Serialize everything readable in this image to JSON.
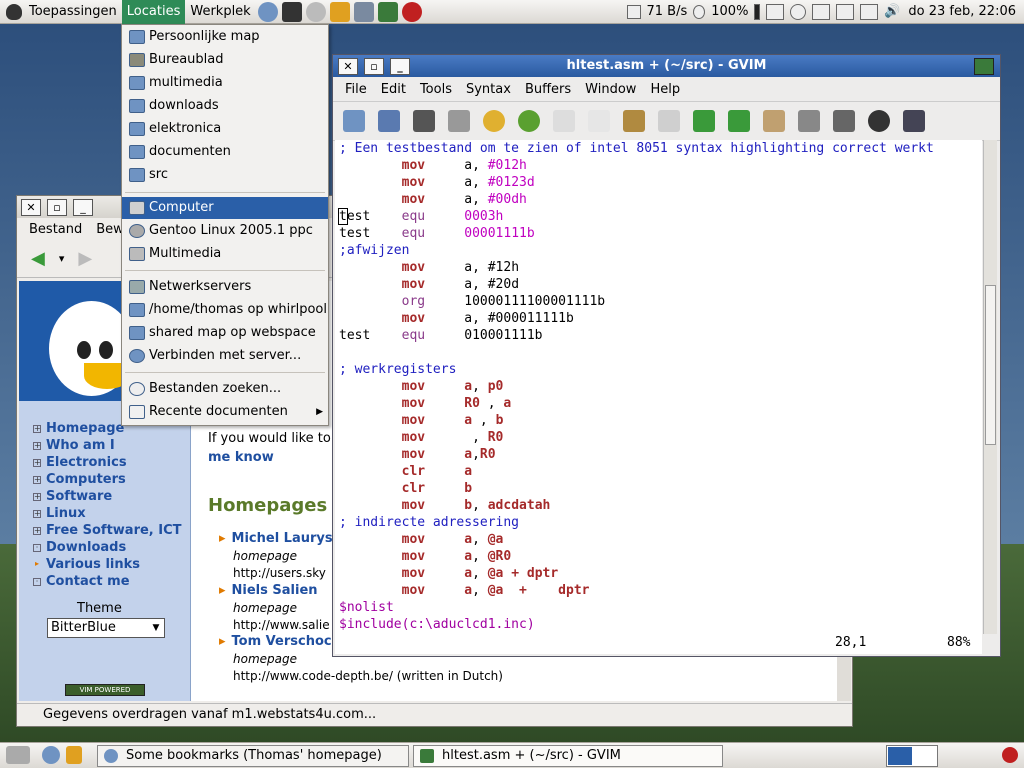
{
  "top_panel": {
    "menus": [
      "Toepassingen",
      "Locaties",
      "Werkplek"
    ],
    "net_speed": "71 B/s",
    "battery": "100%",
    "datetime": "do 23 feb, 22:06"
  },
  "places_menu": {
    "items": [
      "Persoonlijke map",
      "Bureaublad",
      "multimedia",
      "downloads",
      "elektronica",
      "documenten",
      "src",
      "Computer",
      "Gentoo Linux 2005.1 ppc",
      "Multimedia",
      "Netwerkservers",
      "/home/thomas op whirlpool",
      "shared map op webspace",
      "Verbinden met server...",
      "Bestanden zoeken...",
      "Recente documenten"
    ],
    "selected": "Computer"
  },
  "browser": {
    "menu": [
      "Bestand",
      "Bew"
    ],
    "sidebar_links": [
      "Homepage",
      "Who am I",
      "Electronics",
      "Computers",
      "Software",
      "Linux",
      "Free Software, ICT",
      "Downloads",
      "Various links",
      "Contact me"
    ],
    "theme_label": "Theme",
    "theme_value": "BitterBlue",
    "vim_badge": "VIM POWERED",
    "intro": "If you would like to se",
    "me_know": "me know",
    "homepages_title": "Homepages F",
    "entries": [
      {
        "name": "Michel Laurys",
        "tag": "homepage",
        "url": "http://users.sky"
      },
      {
        "name": "Niels Salien",
        "tag": "homepage",
        "url": "http://www.salie"
      },
      {
        "name": "Tom Verschoc",
        "tag": "homepage",
        "url": "http://www.code-depth.be/ (written in Dutch)"
      }
    ],
    "status": "Gegevens overdragen vanaf m1.webstats4u.com..."
  },
  "gvim": {
    "title": "hltest.asm + (~/src) - GVIM",
    "menu": [
      "File",
      "Edit",
      "Tools",
      "Syntax",
      "Buffers",
      "Window",
      "Help"
    ],
    "position": "28,1",
    "percent": "88%"
  },
  "taskbar": {
    "tasks": [
      "Some bookmarks (Thomas' homepage)",
      "hltest.asm + (~/src) - GVIM"
    ]
  }
}
